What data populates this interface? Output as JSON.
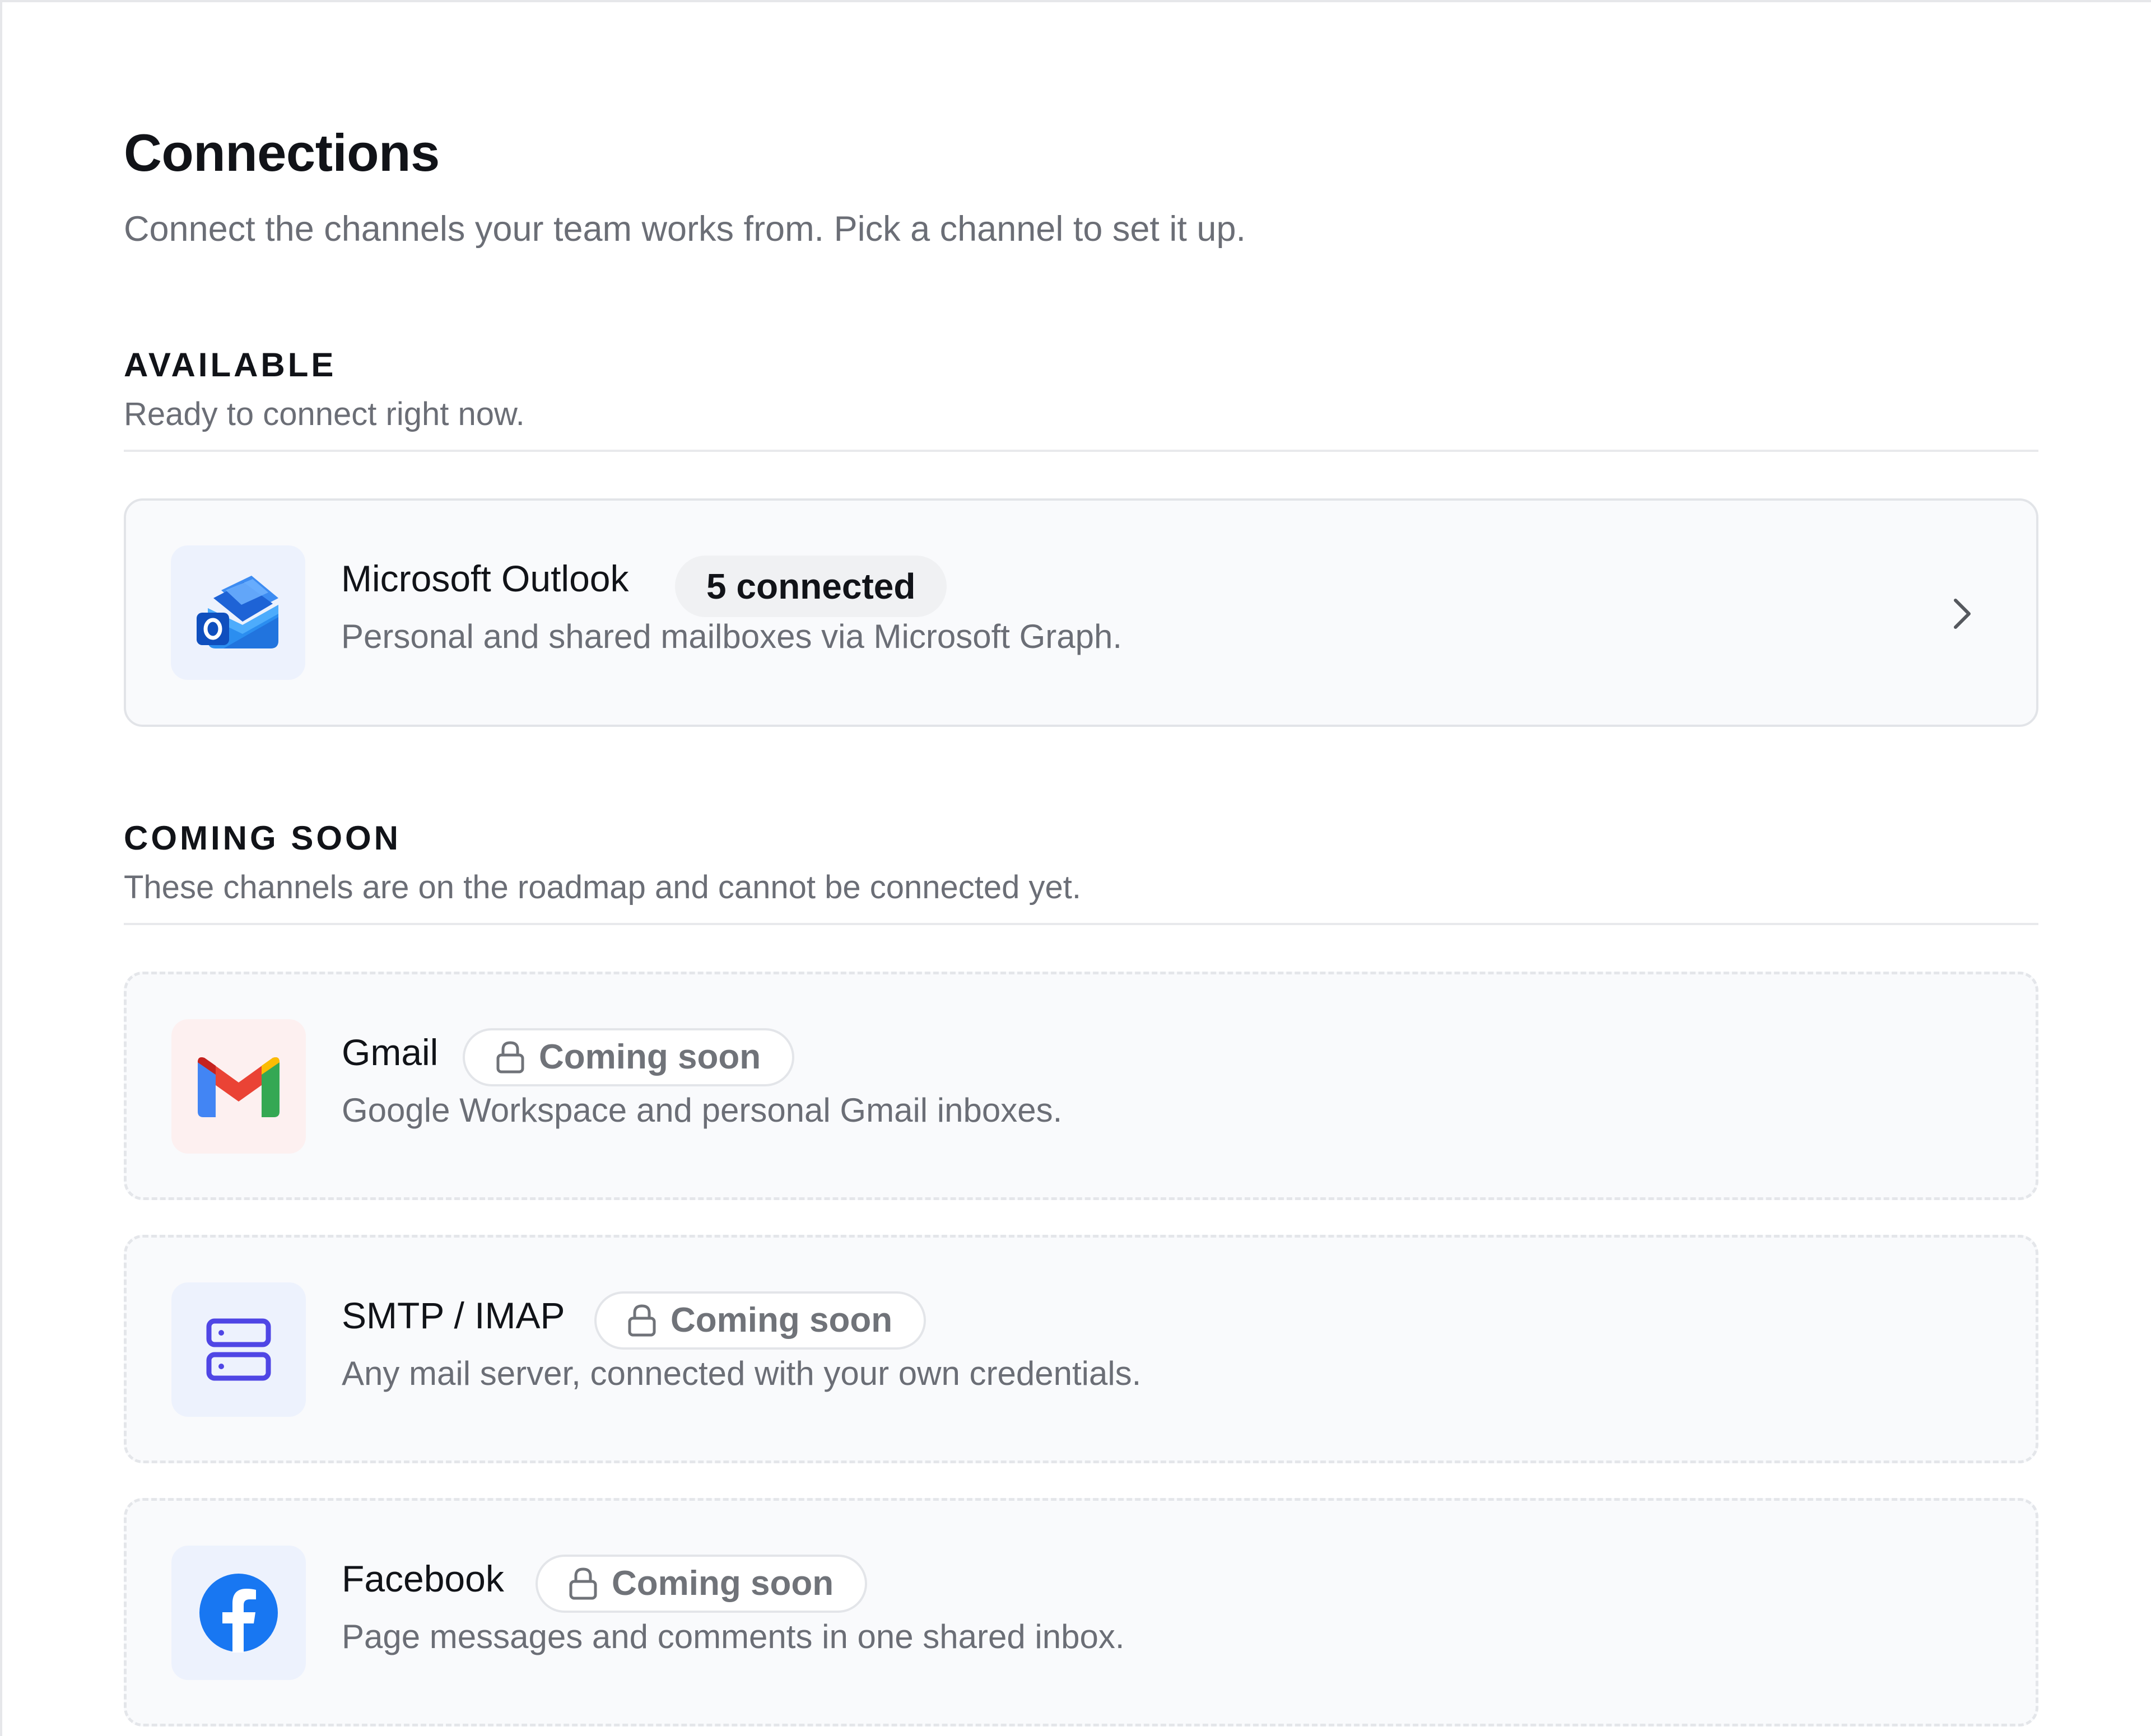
{
  "page": {
    "title": "Connections",
    "subtitle": "Connect the channels your team works from. Pick a channel to set it up."
  },
  "sections": {
    "available": {
      "heading": "AVAILABLE",
      "description": "Ready to connect right now."
    },
    "coming_soon": {
      "heading": "COMING SOON",
      "description": "These channels are on the roadmap and cannot be connected yet."
    }
  },
  "channels": {
    "outlook": {
      "name": "Microsoft Outlook",
      "badge": "5 connected",
      "description": "Personal and shared mailboxes via Microsoft Graph.",
      "icon": "outlook-icon"
    },
    "gmail": {
      "name": "Gmail",
      "badge": "Coming soon",
      "description": "Google Workspace and personal Gmail inboxes.",
      "icon": "gmail-icon"
    },
    "smtp": {
      "name": "SMTP / IMAP",
      "badge": "Coming soon",
      "description": "Any mail server, connected with your own credentials.",
      "icon": "server-icon"
    },
    "facebook": {
      "name": "Facebook",
      "badge": "Coming soon",
      "description": "Page messages and comments in one shared inbox.",
      "icon": "facebook-icon"
    }
  },
  "colors": {
    "card_background": "#f9fafc",
    "icon_tile_blue": "#edf2fd",
    "icon_tile_red": "#fdf0f0",
    "server_icon": "#4f46e5",
    "facebook_brand": "#1877f2",
    "muted_text": "#6b6e76"
  }
}
